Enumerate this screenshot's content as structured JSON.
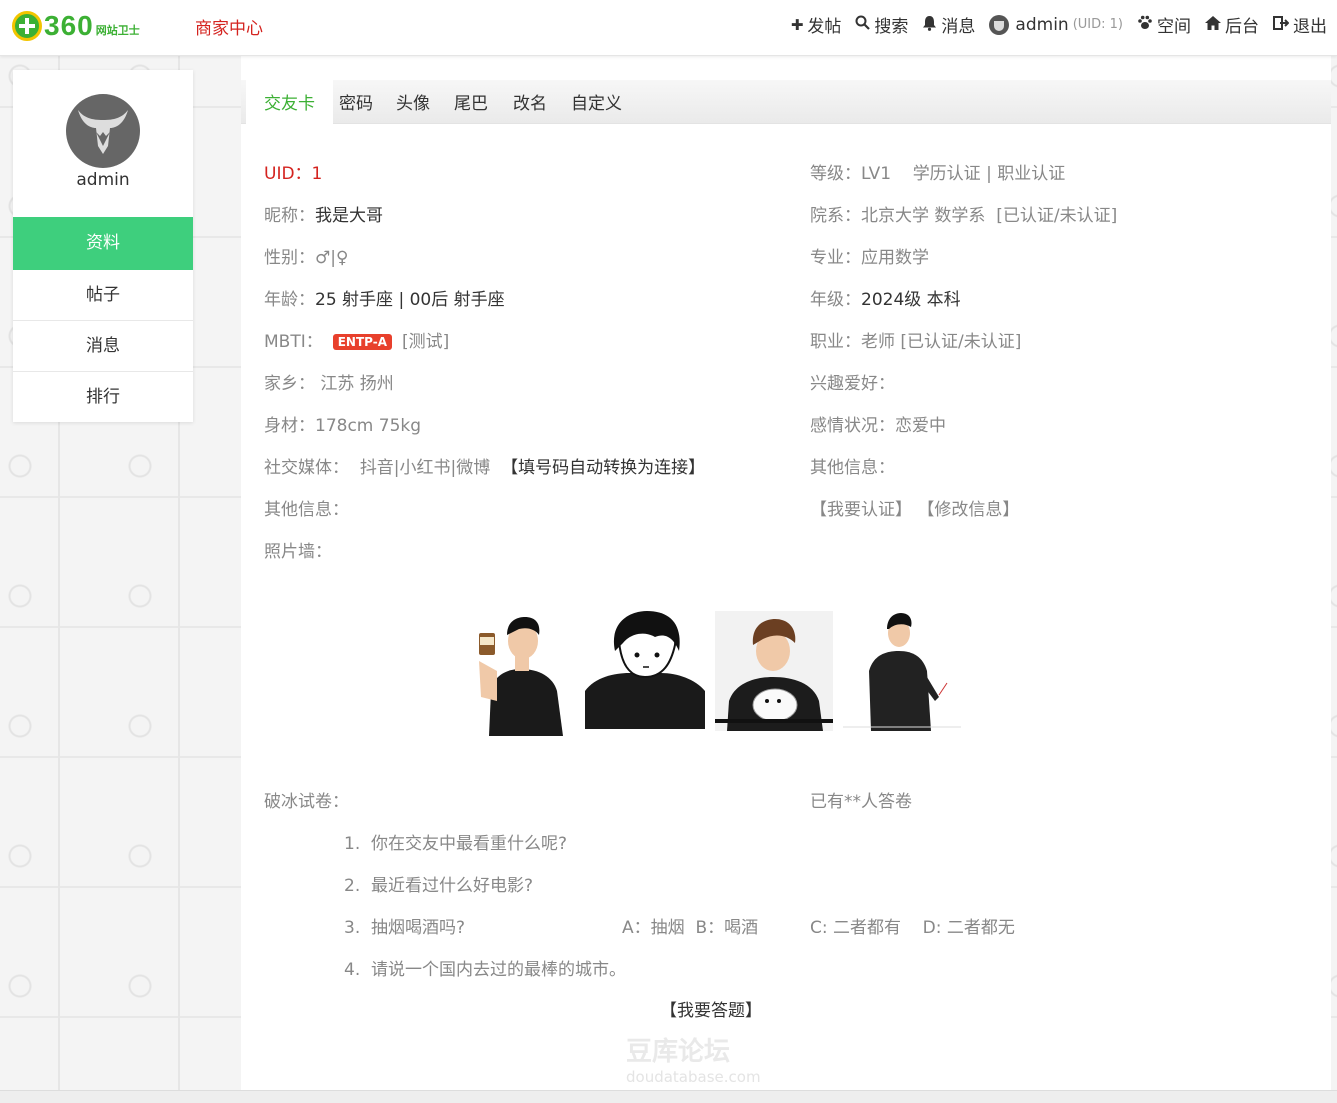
{
  "topbar": {
    "logo_text": "360",
    "logo_sub": "网站卫士",
    "merchant_center": "商家中心",
    "post": "发帖",
    "search": "搜索",
    "messages": "消息",
    "username": "admin",
    "uid_label": "(UID: 1)",
    "space": "空间",
    "admin_panel": "后台",
    "logout": "退出"
  },
  "sidebar": {
    "name": "admin",
    "items": [
      {
        "label": "资料",
        "active": true
      },
      {
        "label": "帖子",
        "active": false
      },
      {
        "label": "消息",
        "active": false
      },
      {
        "label": "排行",
        "active": false
      }
    ]
  },
  "tabs": [
    "交友卡",
    "密码",
    "头像",
    "尾巴",
    "改名",
    "自定义"
  ],
  "profile": {
    "uid_label": "UID：",
    "uid_value": "1",
    "nickname_label": "昵称：",
    "nickname_value": "我是大哥",
    "gender_label": "性别：",
    "gender_value": "♂|♀",
    "age_label": "年龄：",
    "age_value": "25 射手座 | 00后 射手座",
    "mbti_label": "MBTI：",
    "mbti_value": "ENTP-A",
    "mbti_test": "[测试]",
    "hometown_label": "家乡：",
    "hometown_value": "江苏 扬州",
    "body_label": "身材：",
    "body_value": "178cm  75kg",
    "social_label": "社交媒体：",
    "social_value": "抖音|小红书|微博",
    "social_note": "【填号码自动转换为连接】",
    "other_left_label": "其他信息：",
    "photos_label": "照片墙：",
    "level_label": "等级：",
    "level_value": "LV1",
    "level_certs": "学历认证 | 职业认证",
    "college_label": "院系：",
    "college_value": "北京大学 数学系",
    "college_status": "[已认证/未认证]",
    "major_label": "专业：",
    "major_value": "应用数学",
    "grade_label": "年级：",
    "grade_value": "2024级 本科",
    "job_label": "职业：",
    "job_value": "老师 [已认证/未认证]",
    "hobby_label": "兴趣爱好：",
    "relationship_label": "感情状况：",
    "relationship_value": "恋爱中",
    "other_right_label": "其他信息：",
    "certify_link": "【我要认证】",
    "edit_link": "【修改信息】"
  },
  "quiz": {
    "title": "破冰试卷：",
    "answered": "已有**人答卷",
    "questions": [
      {
        "num": "1.",
        "text": "你在交友中最看重什么呢?"
      },
      {
        "num": "2.",
        "text": "最近看过什么好电影?"
      },
      {
        "num": "3.",
        "text": "抽烟喝酒吗?"
      },
      {
        "num": "4.",
        "text": "请说一个国内去过的最棒的城市。"
      }
    ],
    "q3_options": {
      "a": "A：抽烟",
      "b": "B：喝酒",
      "c": "C: 二者都有",
      "d": "D: 二者都无"
    },
    "answer_button": "【我要答题】"
  },
  "watermark": {
    "title": "豆库论坛",
    "sub": "doudatabase.com"
  },
  "colors": {
    "accent_green": "#3ecf7d",
    "brand_red": "#d4231f",
    "tab_active": "#3cb034",
    "badge_red": "#e8402c"
  }
}
